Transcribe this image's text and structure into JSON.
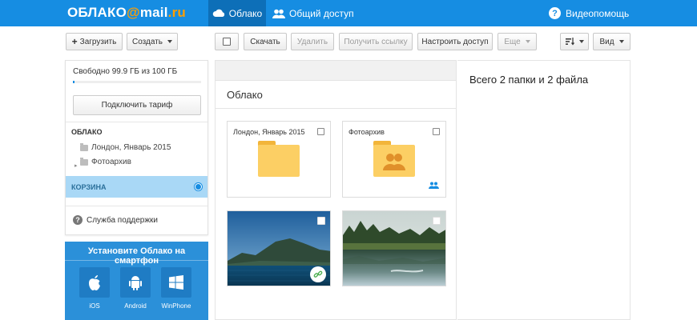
{
  "header": {
    "logo_main": "ОБЛАКО",
    "logo_at": "@",
    "logo_mail": "mail",
    "logo_ru": ".ru",
    "nav_cloud": "Облако",
    "nav_shared": "Общий доступ",
    "nav_help": "Видеопомощь"
  },
  "toolbar": {
    "upload": "Загрузить",
    "create": "Создать",
    "download": "Скачать",
    "delete": "Удалить",
    "get_link": "Получить ссылку",
    "access": "Настроить доступ",
    "more": "Еще",
    "view": "Вид"
  },
  "sidebar": {
    "quota": "Свободно 99.9 ГБ из 100 ГБ",
    "quota_used_fraction": 0.001,
    "tariff_button": "Подключить тариф",
    "section_title": "ОБЛАКО",
    "tree": [
      {
        "label": "Лондон, Январь 2015"
      },
      {
        "label": "Фотоархив"
      }
    ],
    "trash": "КОРЗИНА",
    "support": "Служба поддержки"
  },
  "promo": {
    "title": "Установите Облако на смартфон",
    "stores": [
      "iOS",
      "Android",
      "WinPhone"
    ]
  },
  "main": {
    "title": "Облако",
    "folders": [
      {
        "name": "Лондон, Январь 2015",
        "shared": false
      },
      {
        "name": "Фотоархив",
        "shared": true
      }
    ],
    "photos": [
      {
        "name": "mountain-lake",
        "has_link": true
      },
      {
        "name": "forest-lake",
        "has_link": false
      }
    ]
  },
  "info": {
    "summary": "Всего 2 папки и 2 файла"
  },
  "colors": {
    "brand_blue": "#168de2",
    "logo_orange": "#ff9e00",
    "folder_yellow": "#fccf64",
    "selected_row": "#a9d8f6"
  }
}
